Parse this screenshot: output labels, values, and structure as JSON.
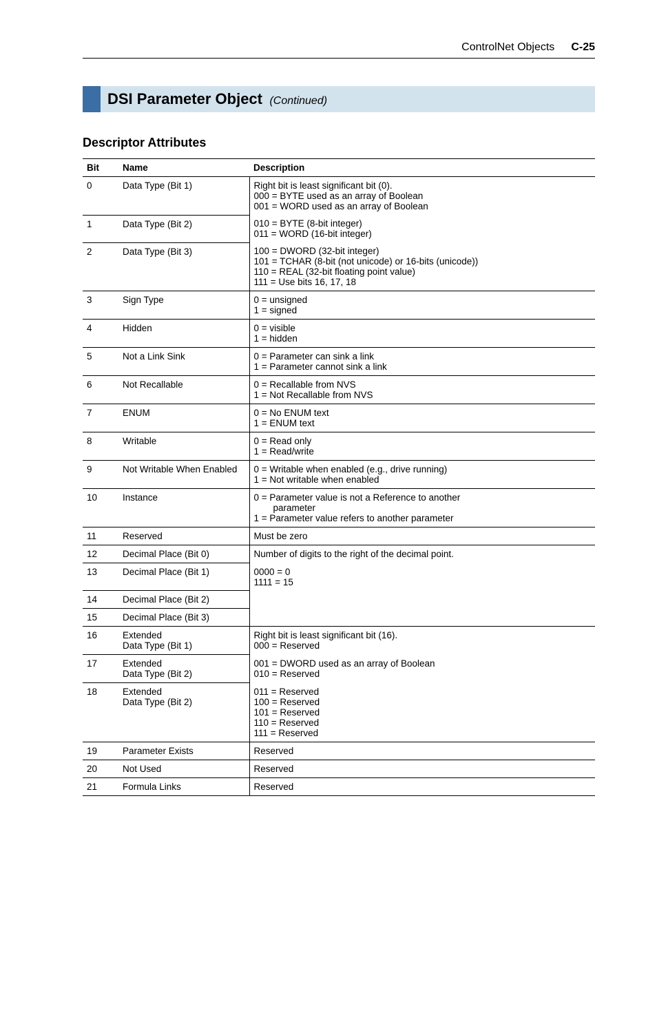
{
  "header": {
    "title": "ControlNet Objects",
    "page": "C-25"
  },
  "section": {
    "title": "DSI Parameter Object",
    "continued": "(Continued)"
  },
  "subhead": "Descriptor Attributes",
  "table": {
    "headers": {
      "bit": "Bit",
      "name": "Name",
      "desc": "Description"
    },
    "rows": [
      {
        "bit": "0",
        "name": "Data Type (Bit 1)",
        "desc": "Right bit is least significant bit (0).\n000 = BYTE used as an array of Boolean\n001 = WORD used as an array of Boolean",
        "desc_border": true
      },
      {
        "bit": "1",
        "name": "Data Type (Bit 2)",
        "desc": "010 = BYTE (8-bit integer)\n011 = WORD (16-bit integer)",
        "desc_border": false
      },
      {
        "bit": "2",
        "name": "Data Type (Bit 3)",
        "desc": "100 = DWORD (32-bit integer)\n101 = TCHAR (8-bit (not unicode) or 16-bits (unicode))\n110 = REAL (32-bit floating point value)\n111 = Use bits 16, 17, 18",
        "desc_border": false
      },
      {
        "bit": "3",
        "name": "Sign Type",
        "desc": "0 = unsigned\n1 = signed",
        "desc_border": true
      },
      {
        "bit": "4",
        "name": "Hidden",
        "desc": "0 = visible\n1 = hidden",
        "desc_border": true
      },
      {
        "bit": "5",
        "name": "Not a Link Sink",
        "desc": "0 = Parameter can sink a link\n1 = Parameter cannot sink a link",
        "desc_border": true
      },
      {
        "bit": "6",
        "name": "Not Recallable",
        "desc": "0 = Recallable from NVS\n1 = Not Recallable from NVS",
        "desc_border": true
      },
      {
        "bit": "7",
        "name": "ENUM",
        "desc": "0 = No ENUM text\n1 = ENUM text",
        "desc_border": true
      },
      {
        "bit": "8",
        "name": "Writable",
        "desc": "0 = Read only\n1 = Read/write",
        "desc_border": true
      },
      {
        "bit": "9",
        "name": "Not Writable When Enabled",
        "desc": "0 = Writable when enabled (e.g., drive running)\n1 = Not writable when enabled",
        "desc_border": true
      },
      {
        "bit": "10",
        "name": "Instance",
        "desc_lines": [
          "0 = Parameter value is not a Reference to another",
          "parameter",
          "1 = Parameter value refers to another parameter"
        ],
        "desc_border": true
      },
      {
        "bit": "11",
        "name": "Reserved",
        "desc": "Must be zero",
        "desc_border": true
      },
      {
        "bit": "12",
        "name": "Decimal Place (Bit 0)",
        "desc": "Number of digits to the right of the decimal point.",
        "desc_border": true
      },
      {
        "bit": "13",
        "name": "Decimal Place (Bit 1)",
        "desc": "0000 = 0\n1111 = 15",
        "desc_border": false
      },
      {
        "bit": "14",
        "name": "Decimal Place (Bit 2)",
        "desc": "",
        "desc_border": false
      },
      {
        "bit": "15",
        "name": "Decimal Place (Bit 3)",
        "desc": "",
        "desc_border": false
      },
      {
        "bit": "16",
        "name": "Extended\nData Type (Bit 1)",
        "desc": "Right bit is least significant bit (16).\n000 = Reserved",
        "desc_border": true
      },
      {
        "bit": "17",
        "name": "Extended\nData Type (Bit 2)",
        "desc": "001 = DWORD used as an array of Boolean\n010 = Reserved",
        "desc_border": false
      },
      {
        "bit": "18",
        "name": "Extended\nData Type (Bit 2)",
        "desc": "011 = Reserved\n100 = Reserved\n101 = Reserved\n110 = Reserved\n111 = Reserved",
        "desc_border": false
      },
      {
        "bit": "19",
        "name": "Parameter Exists",
        "desc": "Reserved",
        "desc_border": true
      },
      {
        "bit": "20",
        "name": "Not Used",
        "desc": "Reserved",
        "desc_border": true
      },
      {
        "bit": "21",
        "name": "Formula Links",
        "desc": "Reserved",
        "desc_border": true
      }
    ]
  }
}
